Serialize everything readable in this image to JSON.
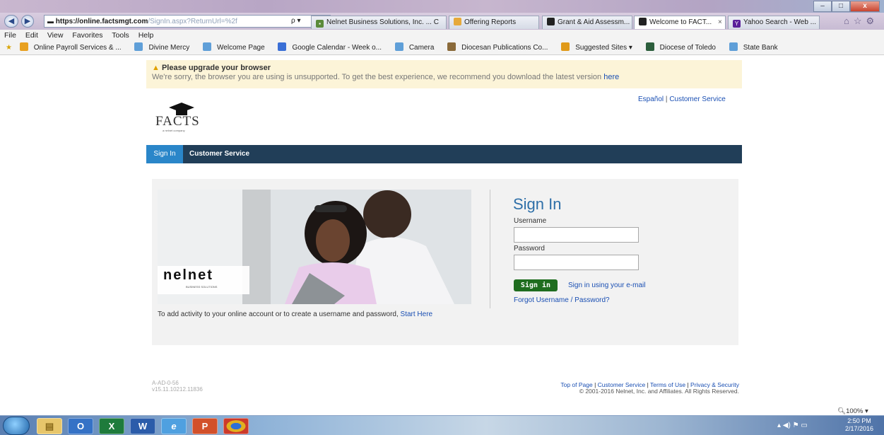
{
  "browser": {
    "address_prefix": "https://online.factsmgt.com",
    "address_rest": "/SignIn.aspx?ReturnUrl=%2f",
    "search_label": "ρ ▾",
    "tabs": [
      {
        "label": "Nelnet Business Solutions, Inc. ... C",
        "icon": "lock-icon"
      },
      {
        "label": "Offering Reports",
        "icon": "page-icon"
      },
      {
        "label": "Grant & Aid Assessm...",
        "icon": "facts-cap-icon"
      },
      {
        "label": "Welcome to FACT...",
        "icon": "facts-cap-icon",
        "close": "×"
      },
      {
        "label": "Yahoo Search - Web ...",
        "icon": "yahoo-icon"
      }
    ],
    "menu": [
      "File",
      "Edit",
      "View",
      "Favorites",
      "Tools",
      "Help"
    ],
    "favorites": [
      "Online Payroll Services & ...",
      "Divine Mercy",
      "Welcome Page",
      "Google Calendar - Week o...",
      "Camera",
      "Diocesan Publications Co...",
      "Suggested Sites ▾",
      "Diocese of Toledo",
      "State Bank"
    ],
    "zoom": "100%",
    "controls": {
      "min": "–",
      "max": "□",
      "close": "x"
    }
  },
  "banner": {
    "title": "Please upgrade your browser",
    "message": "We're sorry, the browser you are using is unsupported. To get the best experience, we recommend you download the latest version",
    "link": "here"
  },
  "header": {
    "lang_link": "Español",
    "sep": "|",
    "service_link": "Customer Service",
    "logo_text": "FACTS",
    "logo_sub": "a nelnet company"
  },
  "nav": {
    "tabs": [
      "Sign In",
      "Customer Service"
    ]
  },
  "left": {
    "brand": "nelnet",
    "brand_sub": "BUSINESS SOLUTIONS",
    "info": "To add activity to your online account or to create a username and password,",
    "info_link": "Start Here"
  },
  "signin": {
    "heading": "Sign In",
    "username_label": "Username",
    "password_label": "Password",
    "button": "Sign in",
    "email_link": "Sign in using your e-mail",
    "forgot_link": "Forgot Username / Password?"
  },
  "footer": {
    "version1": "A-AD-0-56",
    "version2": "v15.11.10212.11836",
    "links": [
      "Top of Page",
      "Customer Service",
      "Terms of Use",
      "Privacy & Security"
    ],
    "copyright": "© 2001-2016 Nelnet, Inc. and Affiliates. All Rights Reserved."
  },
  "taskbar": {
    "apps": [
      "start-orb",
      "file-explorer",
      "outlook",
      "excel",
      "word",
      "internet-explorer",
      "powerpoint",
      "chrome"
    ],
    "app_labels": [
      "O",
      "X",
      "W",
      "e",
      "P"
    ],
    "time": "2:50 PM",
    "date": "2/17/2016"
  }
}
